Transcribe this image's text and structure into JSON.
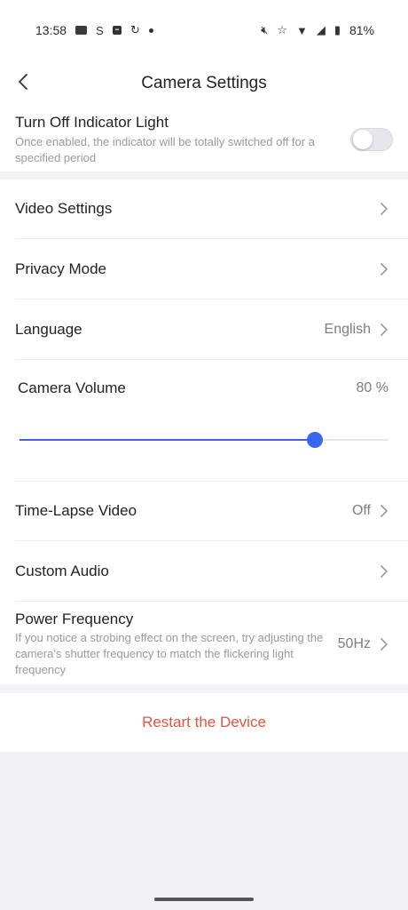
{
  "status_bar": {
    "time": "13:58",
    "battery_percent": "81%",
    "icons_left": [
      "message-icon",
      "s-app-icon",
      "app-badge-icon",
      "sync-icon",
      "dot-icon"
    ],
    "icons_right": [
      "mute-icon",
      "star-icon",
      "wifi-icon",
      "signal-icon",
      "battery-icon"
    ]
  },
  "header": {
    "title": "Camera Settings"
  },
  "indicator": {
    "title": "Turn Off Indicator Light",
    "description": "Once enabled, the indicator will be totally switched off for a specified period",
    "enabled": false
  },
  "rows": {
    "video_settings": {
      "title": "Video Settings"
    },
    "privacy_mode": {
      "title": "Privacy Mode"
    },
    "language": {
      "title": "Language",
      "value": "English"
    },
    "camera_volume": {
      "title": "Camera Volume",
      "value": "80 %",
      "level": 0.8
    },
    "time_lapse": {
      "title": "Time-Lapse Video",
      "value": "Off"
    },
    "custom_audio": {
      "title": "Custom Audio"
    },
    "power_frequency": {
      "title": "Power Frequency",
      "description": "If you notice a strobing effect on the screen, try adjusting the camera's shutter frequency to match the flickering light frequency",
      "value": "50Hz"
    }
  },
  "restart": {
    "label": "Restart the Device"
  },
  "colors": {
    "accent": "#3a66ef",
    "danger": "#e5533f",
    "background": "#f3f2f7"
  }
}
